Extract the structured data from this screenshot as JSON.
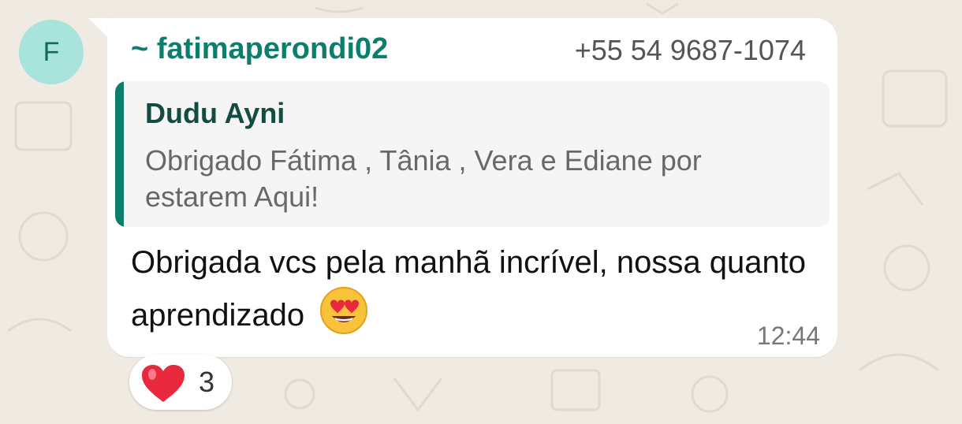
{
  "avatar": {
    "initial": "F"
  },
  "message": {
    "sender": "~ fatimaperondi02",
    "phone": "+55 54 9687-1074",
    "quote": {
      "author": "Dudu Ayni",
      "text": "Obrigado Fátima , Tânia ,  Vera e Ediane por estarem Aqui!"
    },
    "text": "Obrigada vcs pela manhã incrível, nossa quanto aprendizado",
    "emoji": "heart-eyes-emoji",
    "time": "12:44"
  },
  "reaction": {
    "icon": "heart-icon",
    "count": "3"
  },
  "colors": {
    "background": "#efeae2",
    "bubble": "#ffffff",
    "accent": "#0d7d6c",
    "avatar_bg": "#a8e3dc"
  }
}
